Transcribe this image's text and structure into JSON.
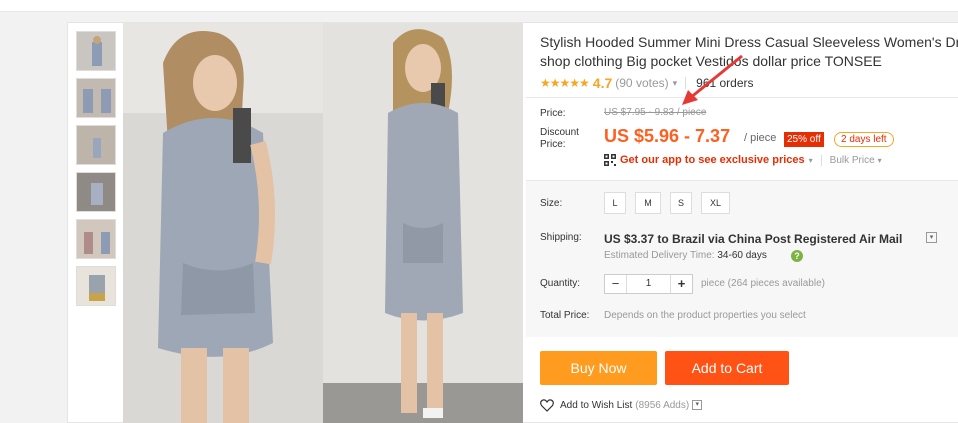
{
  "product": {
    "title_line1": "Stylish Hooded Summer Mini Dress Casual Sleeveless Women's Dress c",
    "title_line2": "shop clothing Big pocket Vestidos dollar price TONSEE",
    "stars": "★★★★★",
    "rating": "4.7",
    "votes": "(90 votes)",
    "orders": "961 orders"
  },
  "price": {
    "label": "Price:",
    "original": "US $7.95 - 9.83 / piece",
    "discount_label_line1": "Discount",
    "discount_label_line2": "Price:",
    "current": "US $5.96 - 7.37",
    "per_piece": "/ piece",
    "off_badge": "25% off",
    "days_left": "2 days left",
    "app_link": "Get our app to see exclusive prices",
    "bulk_price": "Bulk Price"
  },
  "size": {
    "label": "Size:",
    "options": [
      "L",
      "M",
      "S",
      "XL"
    ]
  },
  "shipping": {
    "label": "Shipping:",
    "main": "US $3.37 to Brazil via China Post Registered Air Mail",
    "delivery_label": "Estimated Delivery Time:",
    "delivery_value": "34-60 days",
    "help_glyph": "?"
  },
  "quantity": {
    "label": "Quantity:",
    "minus": "−",
    "value": "1",
    "plus": "+",
    "available": "piece (264 pieces available)"
  },
  "total": {
    "label": "Total Price:",
    "text": "Depends on the product properties you select"
  },
  "actions": {
    "buy_now": "Buy Now",
    "add_to_cart": "Add to Cart",
    "wish_label": "Add to Wish List",
    "wish_adds": "(8956 Adds)"
  },
  "colors": {
    "price_orange": "#ff5f1f",
    "buy_now_bg": "#ff9b1e",
    "add_cart_bg": "#ff5214",
    "annotation_arrow": "#e53935"
  },
  "icons": {
    "rating_caret": "▾",
    "app_caret": "▾",
    "dropdown": "▾"
  }
}
